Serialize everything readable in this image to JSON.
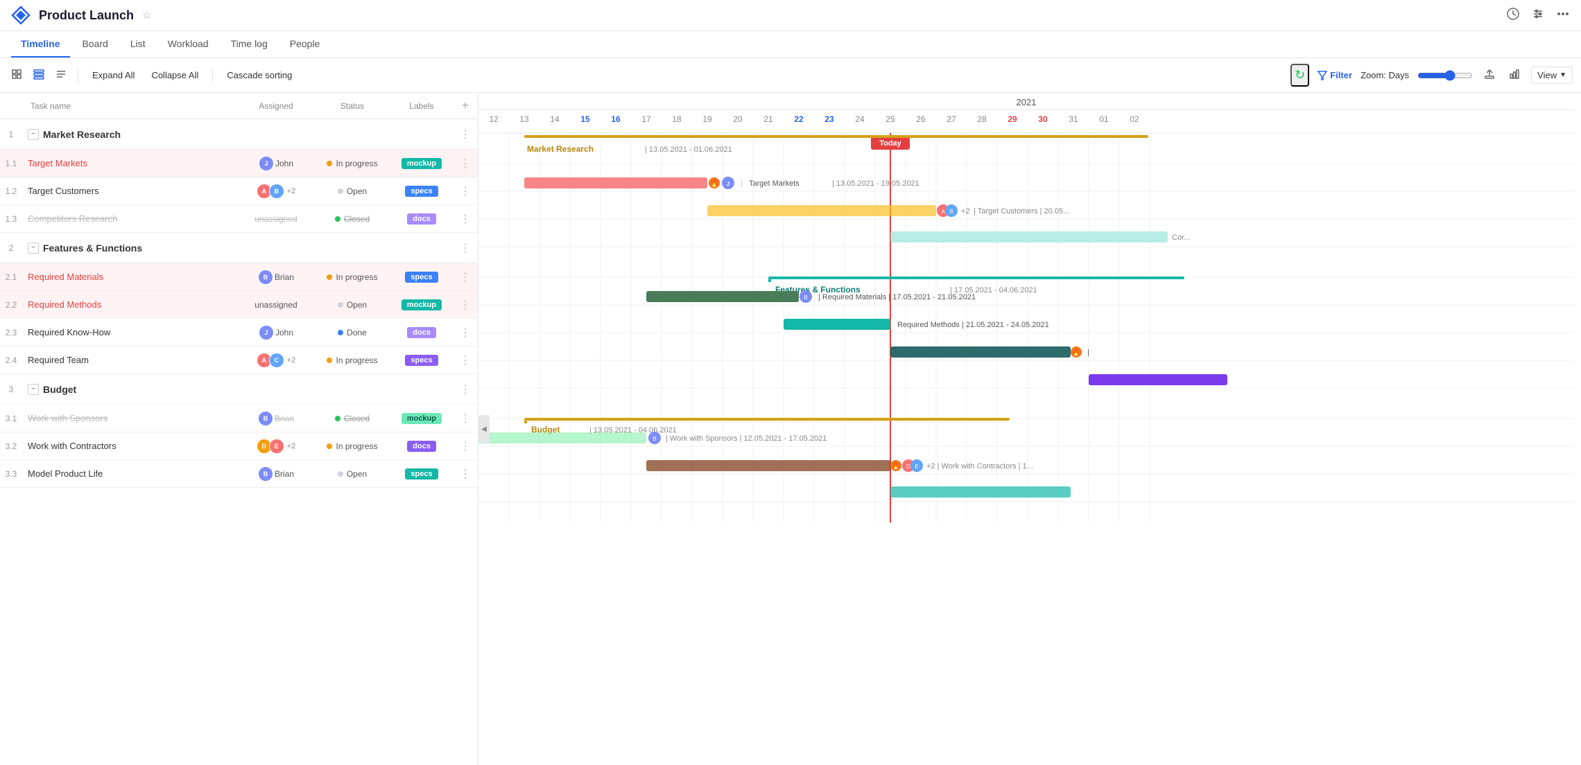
{
  "app": {
    "title": "Product Launch",
    "logo_color": "#2563eb"
  },
  "tabs": [
    {
      "label": "Timeline",
      "active": true
    },
    {
      "label": "Board",
      "active": false
    },
    {
      "label": "List",
      "active": false
    },
    {
      "label": "Workload",
      "active": false
    },
    {
      "label": "Time log",
      "active": false
    },
    {
      "label": "People",
      "active": false
    }
  ],
  "toolbar": {
    "expand_all": "Expand All",
    "collapse_all": "Collapse All",
    "cascade_sorting": "Cascade sorting",
    "filter": "Filter",
    "zoom_label": "Zoom: Days",
    "view_label": "View"
  },
  "table": {
    "headers": {
      "task": "Task name",
      "assigned": "Assigned",
      "status": "Status",
      "labels": "Labels"
    }
  },
  "tasks": [
    {
      "id": "1",
      "type": "group",
      "num": "1",
      "name": "Market Research",
      "assigned": "",
      "status": "",
      "label": "",
      "label_color": "",
      "highlight": ""
    },
    {
      "id": "1.1",
      "type": "subtask",
      "num": "1.1",
      "name": "Target Markets",
      "assigned_avatars": [
        {
          "color": "#7c8cf8",
          "initials": "J"
        }
      ],
      "assigned_text": "John",
      "plus": "",
      "status": "In progress",
      "status_dot": "#f59e0b",
      "label": "mockup",
      "label_color": "#14b8a6",
      "highlight": "red",
      "strikethrough": false,
      "name_style": "link"
    },
    {
      "id": "1.2",
      "type": "subtask",
      "num": "1.2",
      "name": "Target Customers",
      "assigned_avatars": [
        {
          "color": "#f87171",
          "initials": "A"
        },
        {
          "color": "#60a5fa",
          "initials": "B"
        }
      ],
      "assigned_text": "",
      "plus": "+2",
      "status": "Open",
      "status_dot": "#d1d5db",
      "label": "specs",
      "label_color": "#3b82f6",
      "highlight": "",
      "strikethrough": false,
      "name_style": "normal"
    },
    {
      "id": "1.3",
      "type": "subtask",
      "num": "1.3",
      "name": "Competitors Research",
      "assigned_avatars": [],
      "assigned_text": "unassigned",
      "plus": "",
      "status": "Closed",
      "status_dot": "#22c55e",
      "label": "docs",
      "label_color": "#a78bfa",
      "highlight": "",
      "strikethrough": true,
      "name_style": "normal"
    },
    {
      "id": "2",
      "type": "group",
      "num": "2",
      "name": "Features & Functions",
      "assigned": "",
      "status": "",
      "label": "",
      "label_color": "",
      "highlight": ""
    },
    {
      "id": "2.1",
      "type": "subtask",
      "num": "2.1",
      "name": "Required Materials",
      "assigned_avatars": [
        {
          "color": "#7c8cf8",
          "initials": "B"
        }
      ],
      "assigned_text": "Brian",
      "plus": "",
      "status": "In progress",
      "status_dot": "#f59e0b",
      "label": "specs",
      "label_color": "#3b82f6",
      "highlight": "red",
      "strikethrough": false,
      "name_style": "link red"
    },
    {
      "id": "2.2",
      "type": "subtask",
      "num": "2.2",
      "name": "Required Methods",
      "assigned_avatars": [],
      "assigned_text": "unassigned",
      "plus": "",
      "status": "Open",
      "status_dot": "#d1d5db",
      "label": "mockup",
      "label_color": "#14b8a6",
      "highlight": "red",
      "strikethrough": false,
      "name_style": "link red"
    },
    {
      "id": "2.3",
      "type": "subtask",
      "num": "2.3",
      "name": "Required Know-How",
      "assigned_avatars": [
        {
          "color": "#7c8cf8",
          "initials": "J"
        }
      ],
      "assigned_text": "John",
      "plus": "",
      "status": "Done",
      "status_dot": "#3b82f6",
      "label": "docs",
      "label_color": "#a78bfa",
      "highlight": "",
      "strikethrough": false,
      "name_style": "normal"
    },
    {
      "id": "2.4",
      "type": "subtask",
      "num": "2.4",
      "name": "Required Team",
      "assigned_avatars": [
        {
          "color": "#f87171",
          "initials": "A"
        },
        {
          "color": "#60a5fa",
          "initials": "C"
        }
      ],
      "assigned_text": "",
      "plus": "+2",
      "status": "In progress",
      "status_dot": "#f59e0b",
      "label": "specs",
      "label_color": "#8b5cf6",
      "highlight": "",
      "strikethrough": false,
      "name_style": "normal"
    },
    {
      "id": "3",
      "type": "group",
      "num": "3",
      "name": "Budget",
      "assigned": "",
      "status": "",
      "label": "",
      "label_color": "",
      "highlight": ""
    },
    {
      "id": "3.1",
      "type": "subtask",
      "num": "3.1",
      "name": "Work with Sponsors",
      "assigned_avatars": [
        {
          "color": "#7c8cf8",
          "initials": "B"
        }
      ],
      "assigned_text": "Brian",
      "plus": "",
      "status": "Closed",
      "status_dot": "#22c55e",
      "label": "mockup",
      "label_color": "#6ee7b7",
      "highlight": "",
      "strikethrough": true,
      "name_style": "normal"
    },
    {
      "id": "3.2",
      "type": "subtask",
      "num": "3.2",
      "name": "Work with Contractors",
      "assigned_avatars": [
        {
          "color": "#f59e0b",
          "initials": "D"
        },
        {
          "color": "#f87171",
          "initials": "E"
        }
      ],
      "assigned_text": "",
      "plus": "+2",
      "status": "In progress",
      "status_dot": "#f59e0b",
      "label": "docs",
      "label_color": "#8b5cf6",
      "highlight": "",
      "strikethrough": false,
      "name_style": "normal"
    },
    {
      "id": "3.3",
      "type": "subtask",
      "num": "3.3",
      "name": "Model Product Life",
      "assigned_avatars": [
        {
          "color": "#7c8cf8",
          "initials": "B"
        }
      ],
      "assigned_text": "Brian",
      "plus": "",
      "status": "Open",
      "status_dot": "#d1d5db",
      "label": "specs",
      "label_color": "#14b8a6",
      "highlight": "",
      "strikethrough": false,
      "name_style": "normal"
    }
  ],
  "gantt": {
    "year": "2021",
    "days": [
      12,
      13,
      14,
      15,
      16,
      17,
      18,
      19,
      20,
      21,
      22,
      23,
      24,
      25,
      26,
      27,
      28,
      29,
      30,
      31,
      "01",
      "02"
    ],
    "today_day": 25,
    "today_label": "Today"
  },
  "icons": {
    "history": "🕐",
    "settings": "⚙",
    "more": "···",
    "star": "☆",
    "refresh": "↻",
    "filter": "⚡",
    "upload": "⬆",
    "chart": "📊",
    "expand": "⊞",
    "list": "☰",
    "calendar": "📅",
    "collapse-arrow": "◀"
  }
}
